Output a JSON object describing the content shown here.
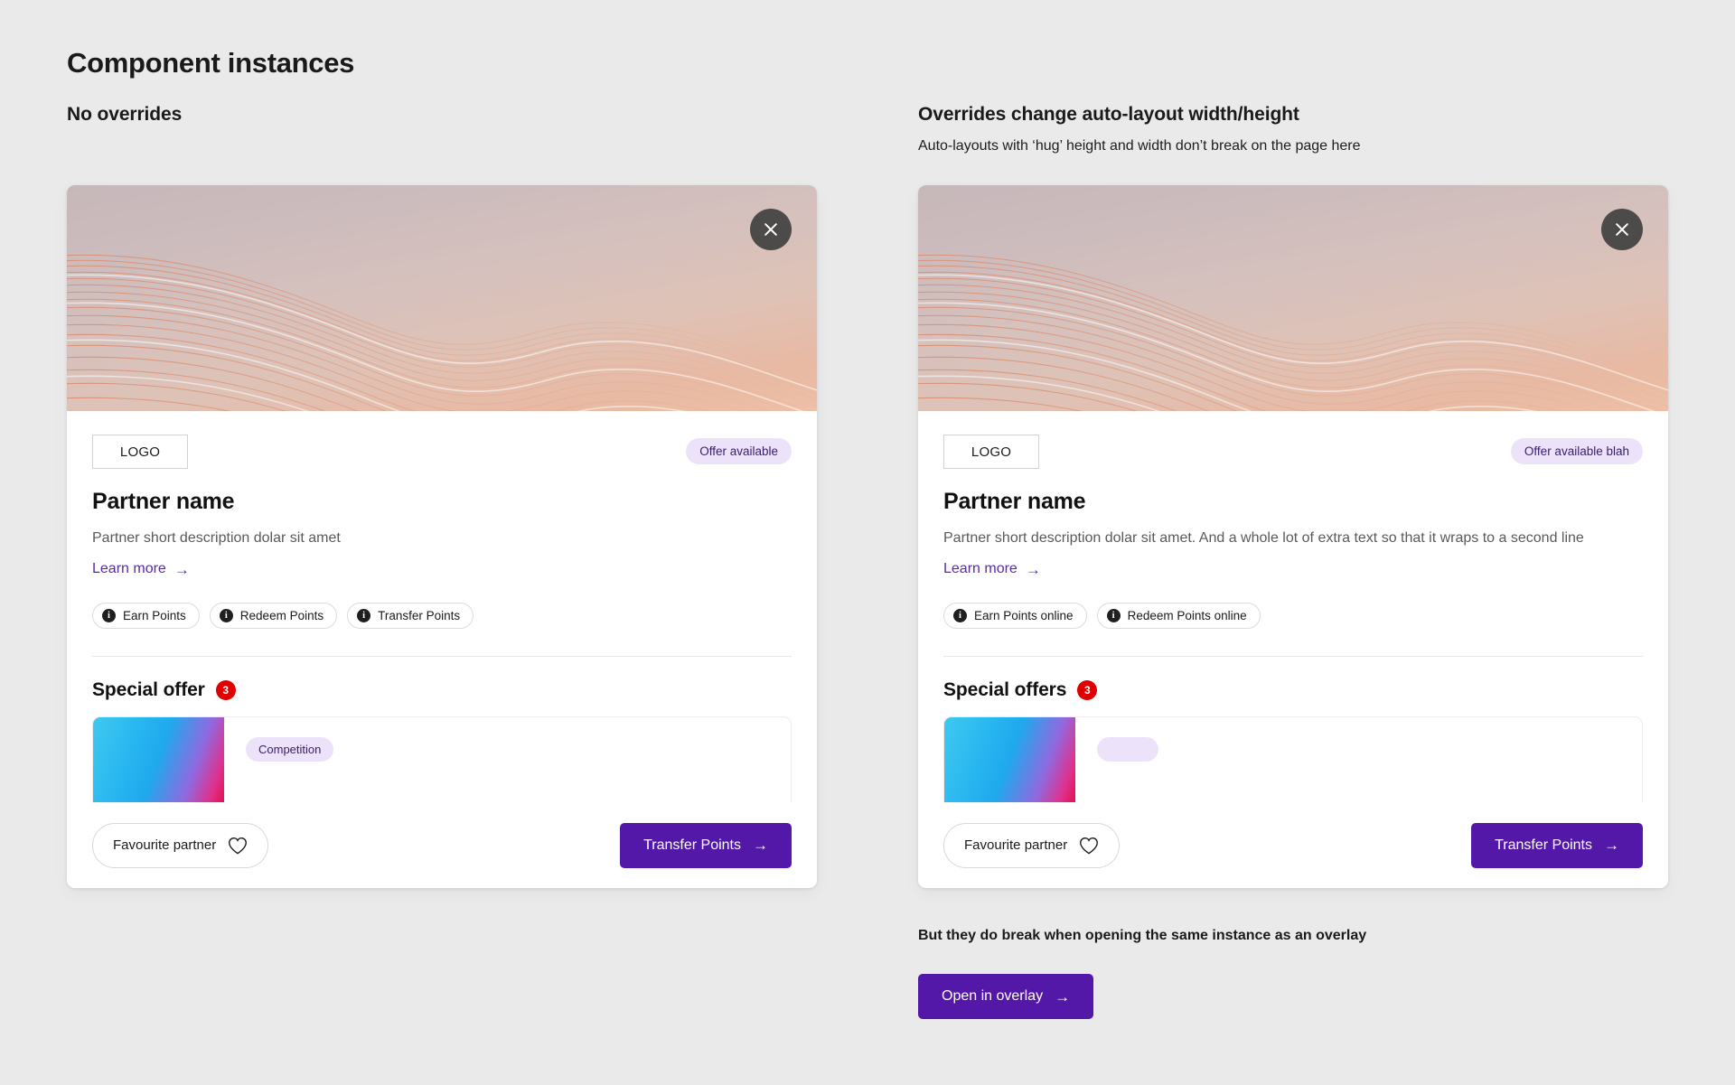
{
  "page": {
    "title": "Component instances",
    "background_color": "#eaeaea"
  },
  "theme": {
    "accent_purple": "#5318a7",
    "link_purple": "#5b2aa5",
    "badge_lavender_bg": "#ece3fa",
    "badge_lavender_text": "#3b1a6e",
    "count_badge_red": "#e00000",
    "card_white": "#ffffff"
  },
  "columns": {
    "left": {
      "heading": "No overrides",
      "subheading": ""
    },
    "right": {
      "heading": "Overrides change auto-layout width/height",
      "subheading": "Auto-layouts with ‘hug’ height and width don’t break on the page here",
      "footer_note": "But they do break when opening the same instance as an overlay",
      "overlay_button_label": "Open in overlay",
      "overlay_button_arrow": "→"
    }
  },
  "card_left": {
    "close_icon": "close-icon",
    "logo_label": "LOGO",
    "offer_badge": "Offer available",
    "partner_name": "Partner name",
    "partner_description": "Partner short description dolar sit amet",
    "learn_more_label": "Learn more",
    "learn_more_arrow": "→",
    "chips": [
      {
        "icon": "info-icon",
        "icon_glyph": "i",
        "label": "Earn Points"
      },
      {
        "icon": "info-icon",
        "icon_glyph": "i",
        "label": "Redeem Points"
      },
      {
        "icon": "info-icon",
        "icon_glyph": "i",
        "label": "Transfer Points"
      }
    ],
    "offers_title": "Special offer",
    "offers_count": "3",
    "offer_tag": "Competition",
    "favourite_label": "Favourite partner",
    "favourite_icon": "heart-icon",
    "primary_label": "Transfer Points",
    "primary_arrow": "→"
  },
  "card_right": {
    "close_icon": "close-icon",
    "logo_label": "LOGO",
    "offer_badge": "Offer available blah",
    "partner_name": "Partner name",
    "partner_description": "Partner short description dolar sit amet. And a whole lot of extra text so that it wraps to a second line",
    "learn_more_label": "Learn more",
    "learn_more_arrow": "→",
    "chips": [
      {
        "icon": "info-icon",
        "icon_glyph": "i",
        "label": "Earn Points online"
      },
      {
        "icon": "info-icon",
        "icon_glyph": "i",
        "label": "Redeem Points online"
      }
    ],
    "offers_title": "Special offers",
    "offers_count": "3",
    "offer_tag": "",
    "favourite_label": "Favourite partner",
    "favourite_icon": "heart-icon",
    "primary_label": "Transfer Points",
    "primary_arrow": "→"
  }
}
